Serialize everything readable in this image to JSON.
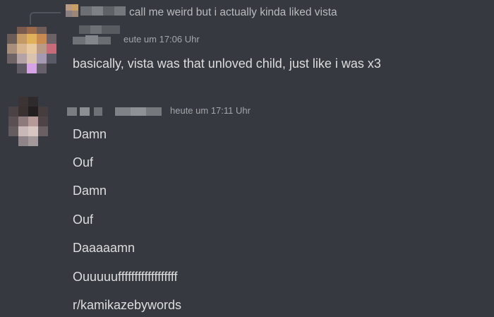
{
  "reply": {
    "quoted_text": "call me weird but i actually kinda liked vista"
  },
  "group1": {
    "timestamp": "eute um 17:06 Uhr",
    "message": "basically, vista was that unloved child, just like i was x3"
  },
  "group2": {
    "timestamp": "heute um 17:11 Uhr",
    "messages": [
      "Damn",
      "Ouf",
      "Damn",
      "Ouf",
      "Daaaaamn",
      "Ouuuuuffffffffffffffffff",
      "r/kamikazebywords"
    ]
  },
  "colors": {
    "background": "#36393f",
    "message_text": "#dcddde",
    "muted_text": "#a3a6aa",
    "reply_text": "#b9bbbe"
  }
}
